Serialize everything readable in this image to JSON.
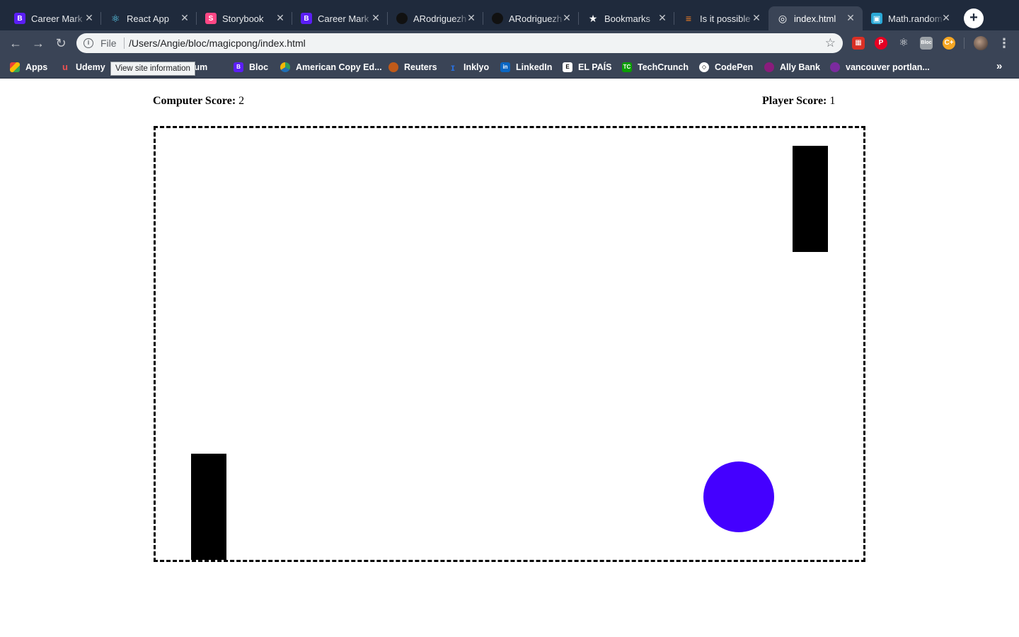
{
  "browser": {
    "tabs": [
      {
        "title": "Career Mark",
        "favicon_text": "B",
        "favicon_color": "#5b1ef5"
      },
      {
        "title": "React App",
        "favicon_text": "⚛",
        "favicon_color": "#1f2a3c"
      },
      {
        "title": "Storybook",
        "favicon_text": "S",
        "favicon_color": "#ff4785"
      },
      {
        "title": "Career Mark",
        "favicon_text": "B",
        "favicon_color": "#5b1ef5"
      },
      {
        "title": "ARodriguezh",
        "favicon_text": "",
        "favicon_color": "#1f2a3c"
      },
      {
        "title": "ARodriguezh",
        "favicon_text": "",
        "favicon_color": "#1f2a3c"
      },
      {
        "title": "Bookmarks",
        "favicon_text": "★",
        "favicon_color": "#1f2a3c"
      },
      {
        "title": "Is it possible",
        "favicon_text": "≡",
        "favicon_color": "#f48024"
      },
      {
        "title": "index.html",
        "favicon_text": "◎",
        "favicon_color": "#3a4456",
        "active": true
      },
      {
        "title": "Math.random",
        "favicon_text": "▣",
        "favicon_color": "#2aa8d6"
      }
    ],
    "address_bar": {
      "scheme_label": "File",
      "url": "/Users/Angie/bloc/magicpong/index.html"
    },
    "tooltip": "View site information",
    "bookmarks": [
      {
        "label": "Apps",
        "icon_color": "#e8453c"
      },
      {
        "label": "Udemy",
        "icon_color": "#ec5252"
      },
      {
        "label": "Medium",
        "icon_color": "#000000"
      },
      {
        "label": "Bloc",
        "icon_color": "#5b1ef5"
      },
      {
        "label": "American Copy Ed...",
        "icon_color": "#2e9e5b"
      },
      {
        "label": "Reuters",
        "icon_color": "#fa6400"
      },
      {
        "label": "Inklyo",
        "icon_color": "#2a6fdb"
      },
      {
        "label": "LinkedIn",
        "icon_color": "#0a66c2"
      },
      {
        "label": "EL PAÍS",
        "icon_color": "#ffffff"
      },
      {
        "label": "TechCrunch",
        "icon_color": "#0a9e01"
      },
      {
        "label": "CodePen",
        "icon_color": "#ffffff"
      },
      {
        "label": "Ally Bank",
        "icon_color": "#8a1c7c"
      },
      {
        "label": "vancouver portlan...",
        "icon_color": "#7b2b9e"
      }
    ]
  },
  "game": {
    "computer_score_label": "Computer Score:",
    "computer_score": "2",
    "player_score_label": "Player Score:",
    "player_score": "1",
    "ball_color": "#4400ff",
    "paddle_color": "#000000"
  }
}
